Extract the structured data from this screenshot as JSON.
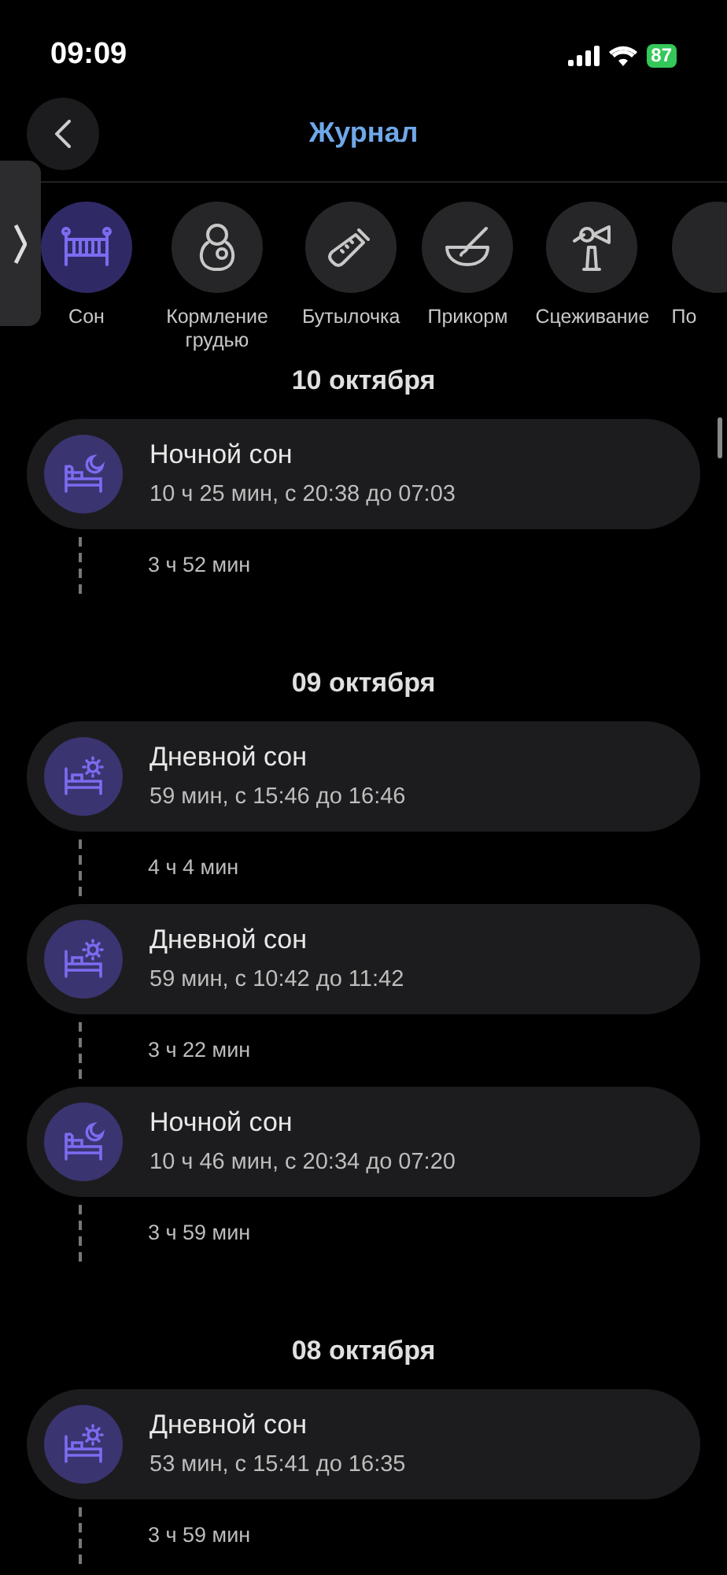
{
  "status_bar": {
    "time": "09:09",
    "battery": "87"
  },
  "header": {
    "title": "Журнал"
  },
  "categories": [
    {
      "kind": "sleep",
      "label": "Сон",
      "selected": true
    },
    {
      "kind": "breast",
      "label": "Кормление грудью",
      "selected": false
    },
    {
      "kind": "bottle",
      "label": "Бутылочка",
      "selected": false
    },
    {
      "kind": "solid",
      "label": "Прикорм",
      "selected": false
    },
    {
      "kind": "pump",
      "label": "Сцеживание",
      "selected": false
    },
    {
      "kind": "more",
      "label": "По",
      "selected": false
    }
  ],
  "days": [
    {
      "date": "10 октября",
      "entries": [
        {
          "kind": "night",
          "title": "Ночной сон",
          "details": "10 ч 25 мин, с 20:38 до 07:03",
          "gap": "3 ч 52 мин"
        }
      ]
    },
    {
      "date": "09 октября",
      "entries": [
        {
          "kind": "day",
          "title": "Дневной сон",
          "details": "59 мин, с 15:46 до 16:46",
          "gap": "4 ч 4 мин"
        },
        {
          "kind": "day",
          "title": "Дневной сон",
          "details": "59 мин, с 10:42 до 11:42",
          "gap": "3 ч 22 мин"
        },
        {
          "kind": "night",
          "title": "Ночной сон",
          "details": "10 ч 46 мин, с 20:34 до 07:20",
          "gap": "3 ч 59 мин"
        }
      ]
    },
    {
      "date": "08 октября",
      "entries": [
        {
          "kind": "day",
          "title": "Дневной сон",
          "details": "53 мин, с 15:41 до 16:35",
          "gap": "3 ч 59 мин"
        }
      ]
    }
  ]
}
